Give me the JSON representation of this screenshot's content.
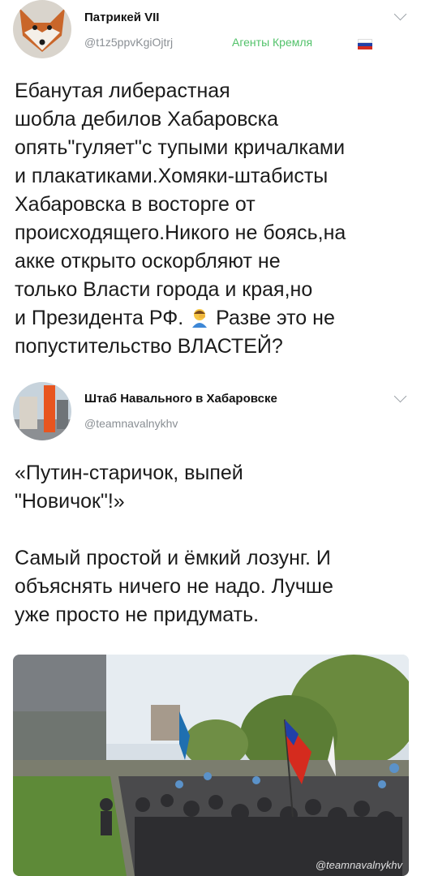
{
  "tweet1": {
    "author_name": "Патрикей VII",
    "handle": "@t1z5ppvKgiOjtrj",
    "badge": "Агенты Кремля",
    "text_before_emoji": "Ебанутая либерастная\nшобла дебилов Хабаровска\nопять\"гуляет\"с тупыми кричалками\nи плакатиками.Хомяки-штабисты\nХабаровска в восторге от\nпроисходящего.Никого не боясь,на\nакке открыто оскорбляют не\nтолько Власти города и края,но\nи Президента РФ. ",
    "text_after_emoji": " Разве это не\nпопустительство ВЛАСТЕЙ?",
    "emoji": "person-facepalming"
  },
  "tweet2": {
    "author_name": "Штаб Навального в Хабаровске",
    "handle": "@teamnavalnykhv",
    "text": "«Путин-старичок, выпей\n\"Новичок\"!»\n\nСамый простой и ёмкий лозунг. И\nобъяснять ничего не надо. Лучше\nуже просто не придумать.",
    "photo_watermark": "@teamnavalnykhv"
  },
  "colors": {
    "handle_gray": "#8a8f94",
    "badge_green": "#52c26a"
  }
}
